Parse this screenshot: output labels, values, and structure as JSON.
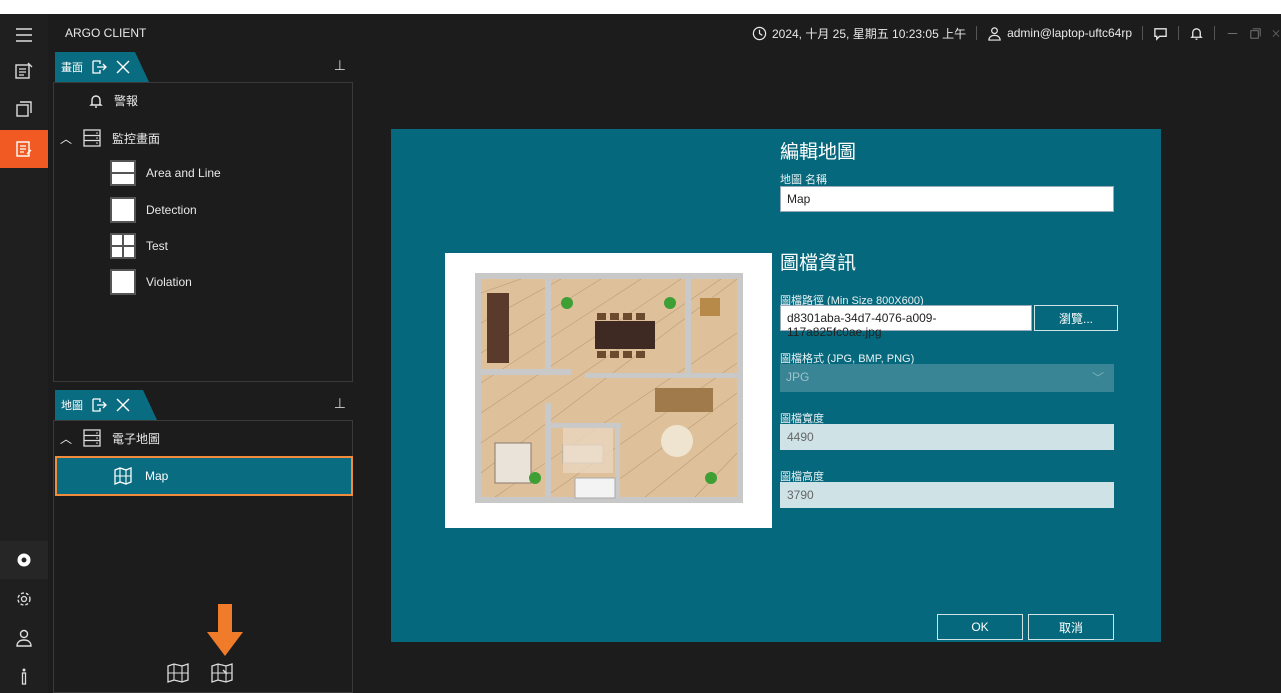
{
  "app": {
    "title": "ARGO CLIENT"
  },
  "statusbar": {
    "datetime": "2024, 十月 25, 星期五 10:23:05 上午",
    "user": "admin@laptop-uftc64rp"
  },
  "panels": {
    "screens": {
      "tab_label": "畫面",
      "items": [
        {
          "label": "警報"
        },
        {
          "label": "監控畫面"
        },
        {
          "label": "Area and Line"
        },
        {
          "label": "Detection"
        },
        {
          "label": "Test"
        },
        {
          "label": "Violation"
        }
      ]
    },
    "maps": {
      "tab_label": "地圖",
      "group_label": "電子地圖",
      "selected_item": "Map"
    }
  },
  "dialog": {
    "edit_heading": "編輯地圖",
    "name_label": "地圖 名稱",
    "name_value": "Map",
    "info_heading": "圖檔資訊",
    "path_label": "圖檔路徑 (Min Size 800X600)",
    "path_value": "d8301aba-34d7-4076-a009-117a825fc0ae.jpg",
    "browse_label": "瀏覽...",
    "format_label": "圖檔格式 (JPG, BMP, PNG)",
    "format_value": "JPG",
    "width_label": "圖檔寬度",
    "width_value": "4490",
    "height_label": "圖檔高度",
    "height_value": "3790",
    "ok_label": "OK",
    "cancel_label": "取消"
  },
  "colors": {
    "accent": "#f15a22",
    "teal": "#06687c",
    "dark": "#1c1c1c"
  }
}
